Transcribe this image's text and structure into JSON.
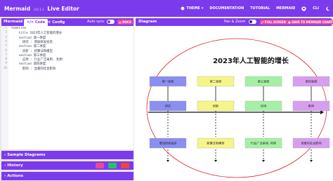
{
  "header": {
    "brand": "Mermaid",
    "version": "v11.1.1",
    "title": "Live Editor",
    "nav": [
      "THEME",
      "DOCUMENTATION",
      "TUTORIAL",
      "MERMAID",
      "CLI"
    ]
  },
  "editor_panel": {
    "label": "Mermaid",
    "tabs": [
      "Code",
      "Config"
    ],
    "auto_sync": "Auto sync",
    "docs": "DOCS",
    "lines": [
      [
        "1",
        "timeline"
      ],
      [
        "2",
        "    title 2023年人工智能的增长"
      ],
      [
        "3",
        "    section 第一季度"
      ],
      [
        "4",
        "      研究 : 增加研发投资"
      ],
      [
        "5",
        "    section 第二季度"
      ],
      [
        "6",
        "      创新 : 新算法和模型"
      ],
      [
        "7",
        "    section 第三季度"
      ],
      [
        "8",
        "      应用 : 行业广泛采用, 利用"
      ],
      [
        "9",
        "    section 第四季度"
      ],
      [
        "10",
        "      影响 : 显著的社会影响"
      ]
    ]
  },
  "collapsibles": [
    "Sample Diagrams",
    "History",
    "Actions"
  ],
  "diagram_panel": {
    "label": "Diagram",
    "pan_zoom": "Pan & Zoom",
    "full_screen": "FULL SCREEN",
    "save": "SAVE TO MERMAID CHART"
  },
  "timeline": {
    "title": "2023年人工智能的增长",
    "sections": [
      {
        "name": "第一季度",
        "event": "研究",
        "note": "增加研发投资",
        "color": "#8b8ff2"
      },
      {
        "name": "第二季度",
        "event": "创新",
        "note": "新算法和模型",
        "color": "#f5f58a"
      },
      {
        "name": "第三季度",
        "event": "应用",
        "note": "行业广泛采用, 利用",
        "color": "#a6f0a6"
      },
      {
        "name": "第四季度",
        "event": "影响",
        "note": "显著的社会影响",
        "color": "#d79ef0"
      }
    ]
  },
  "colors": {
    "accent": "#7c3aed",
    "pink": "#ec4899",
    "ellipse": "#dc2626"
  }
}
